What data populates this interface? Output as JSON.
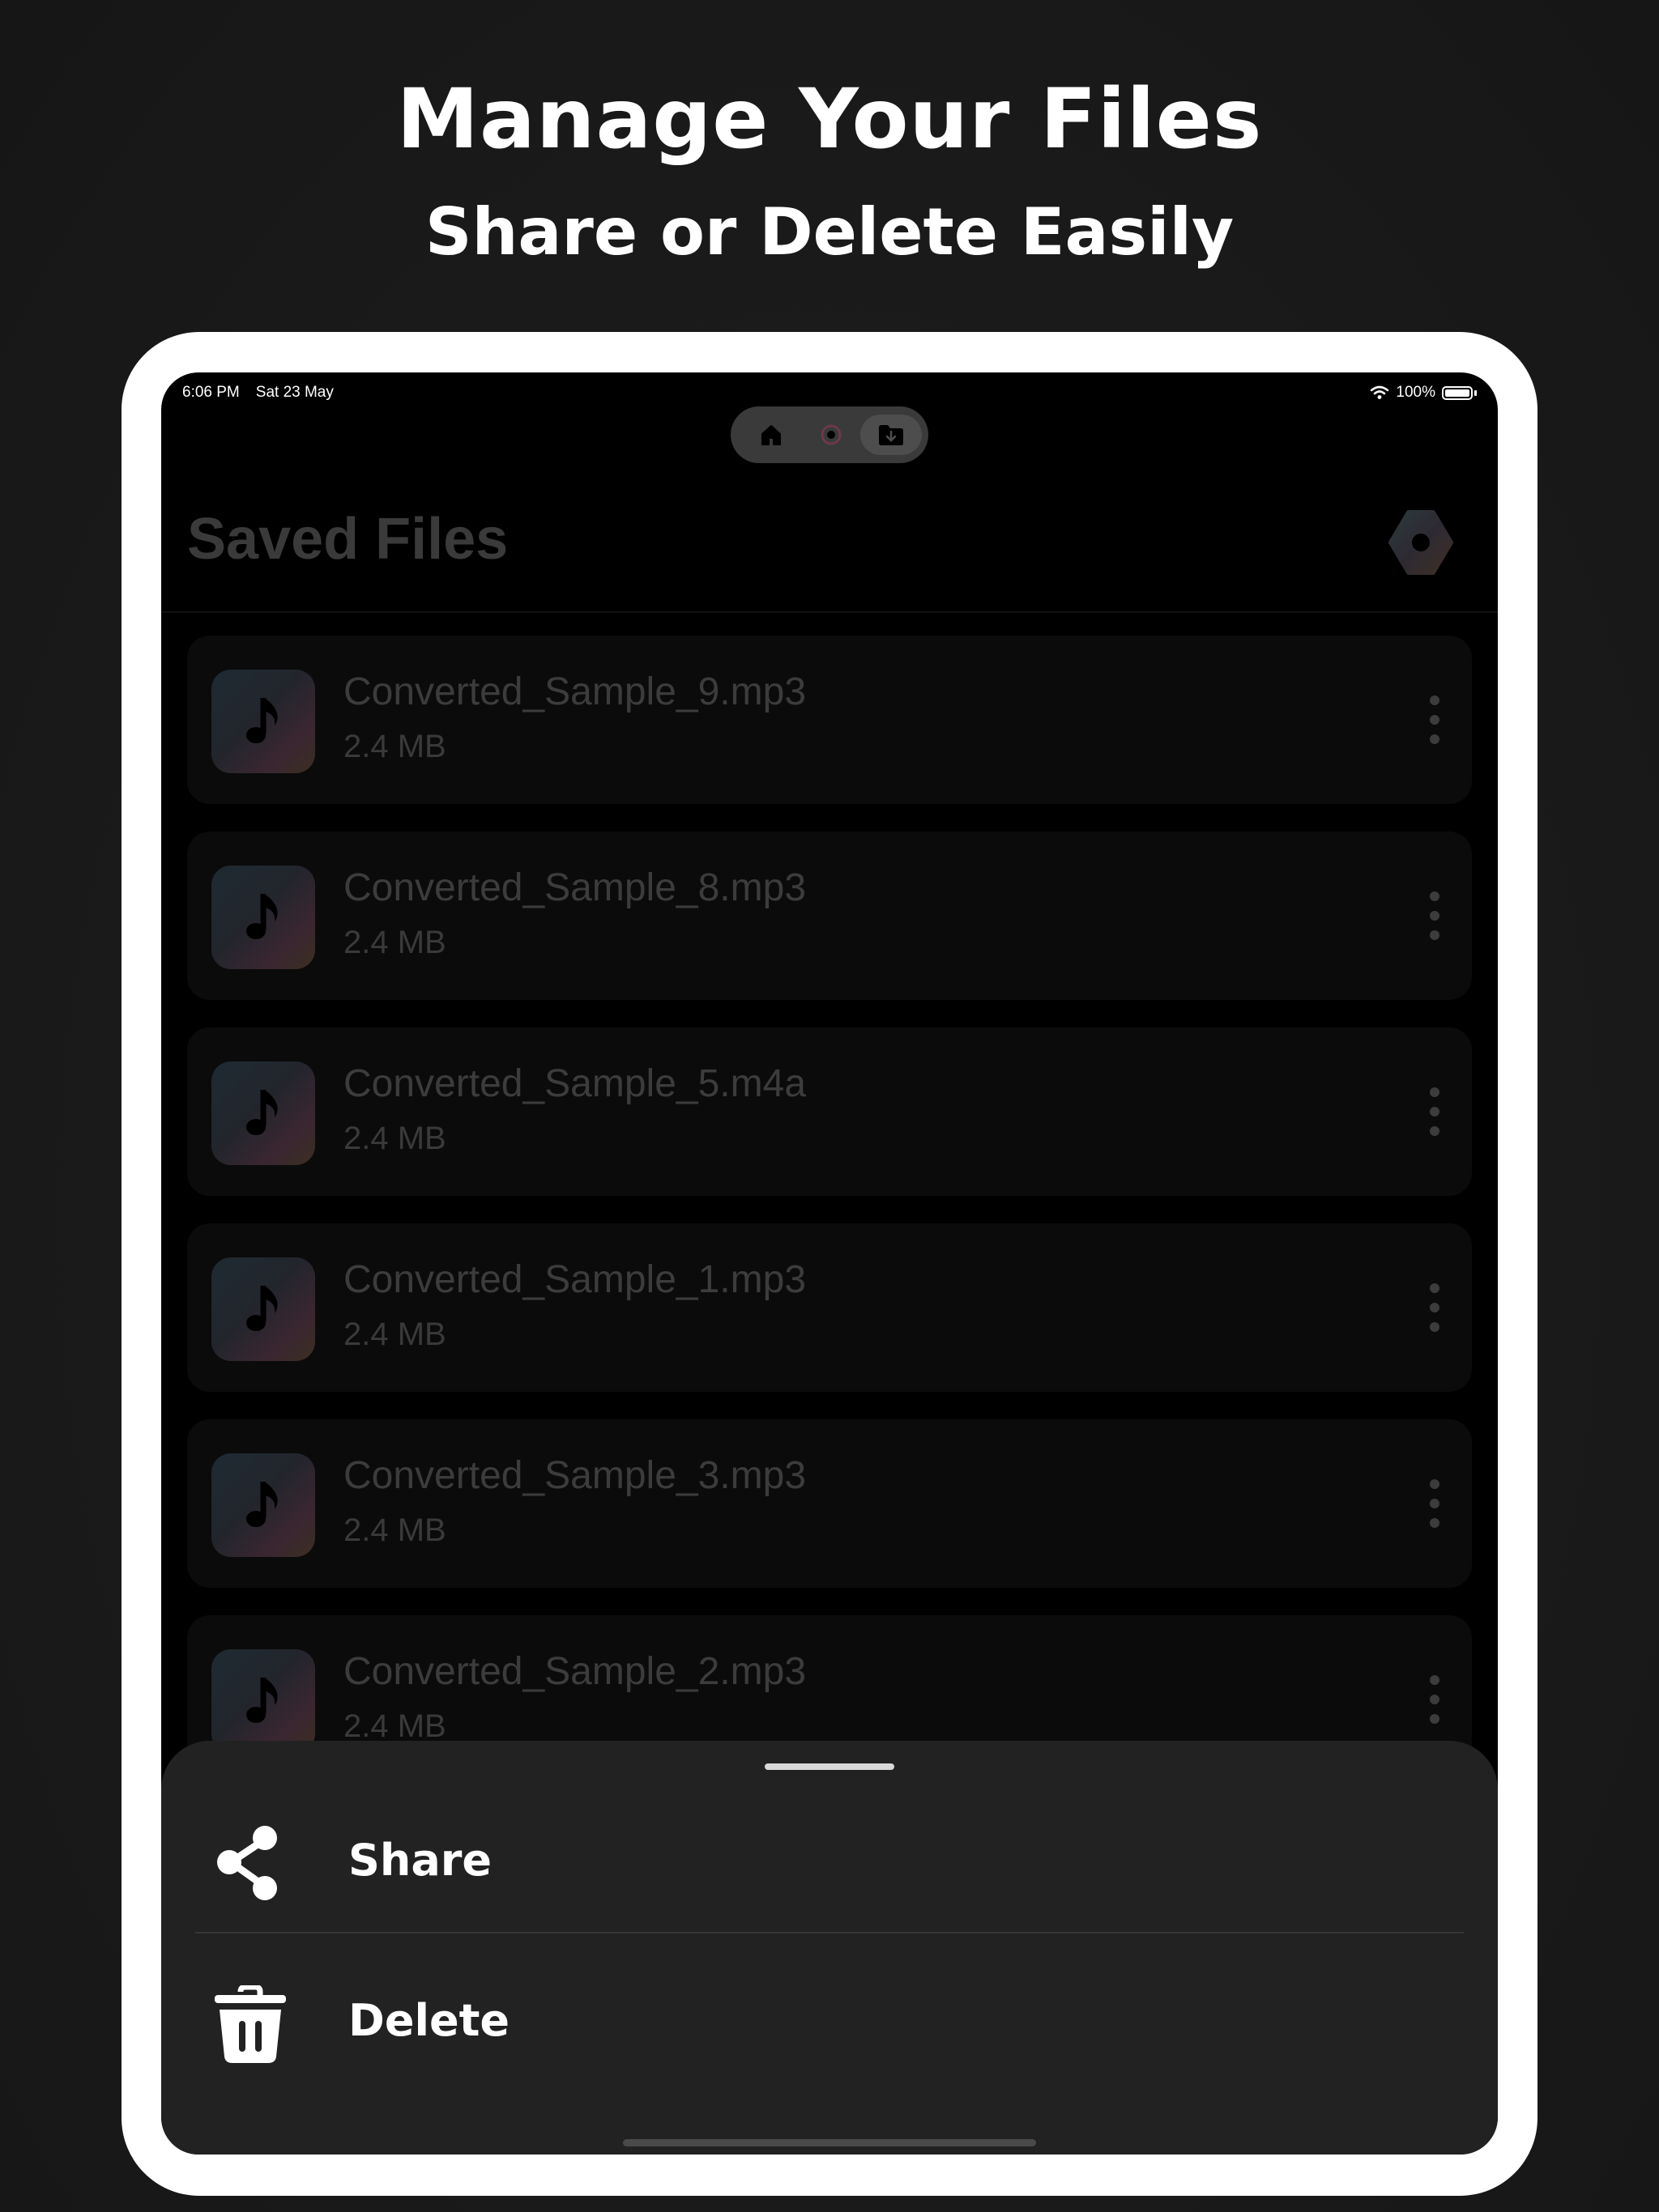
{
  "promo": {
    "headline": "Manage Your Files",
    "subheadline": "Share or Delete Easily"
  },
  "status_bar": {
    "time": "6:06 PM",
    "date": "Sat 23 May",
    "battery": "100%"
  },
  "tabs": [
    {
      "name": "home",
      "icon": "house-icon"
    },
    {
      "name": "convert",
      "icon": "convert-icon"
    },
    {
      "name": "saved-files",
      "icon": "folder-download-icon",
      "active": true
    }
  ],
  "header": {
    "title": "Saved Files",
    "settings_icon": "gear-icon"
  },
  "files": [
    {
      "name": "Converted_Sample_9.mp3",
      "size": "2.4 MB"
    },
    {
      "name": "Converted_Sample_8.mp3",
      "size": "2.4 MB"
    },
    {
      "name": "Converted_Sample_5.m4a",
      "size": "2.4 MB"
    },
    {
      "name": "Converted_Sample_1.mp3",
      "size": "2.4 MB"
    },
    {
      "name": "Converted_Sample_3.mp3",
      "size": "2.4 MB"
    },
    {
      "name": "Converted_Sample_2.mp3",
      "size": "2.4 MB"
    }
  ],
  "action_sheet": {
    "share_label": "Share",
    "delete_label": "Delete",
    "share_icon": "share-icon",
    "delete_icon": "trash-icon"
  },
  "colors": {
    "background": "#1a1a1a",
    "device_frame": "#ffffff",
    "screen": "#000000",
    "sheet": "#222222",
    "dimmed_text": "#3c3c3c"
  }
}
